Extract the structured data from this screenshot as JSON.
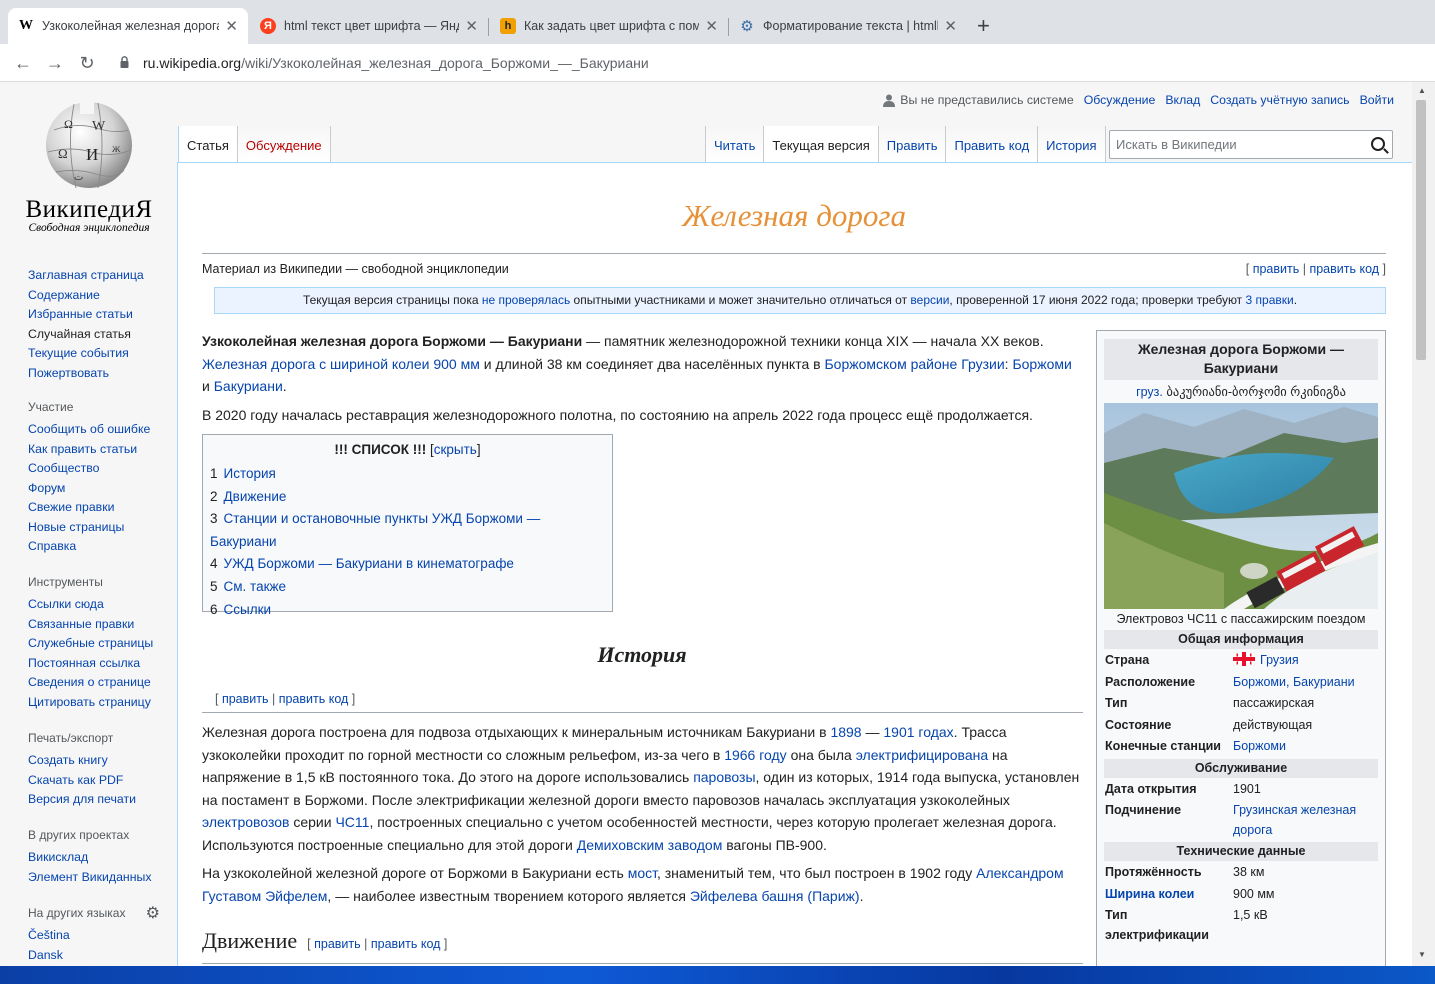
{
  "browser": {
    "tabs": [
      {
        "title": "Узкоколейная железная дорога",
        "favicon": "W"
      },
      {
        "title": "html текст цвет шрифта — Яндекс",
        "favicon": "Я"
      },
      {
        "title": "Как задать цвет шрифта с помо",
        "favicon": "h"
      },
      {
        "title": "Форматирование текста | htmlb",
        "favicon": "gear"
      }
    ],
    "url_host": "ru.wikipedia.org",
    "url_path": "/wiki/Узкоколейная_железная_дорога_Боржоми_—_Бакуриани"
  },
  "wiki": {
    "name": "ВикипедиЯ",
    "tagline": "Свободная энциклопедия",
    "nav": [
      "Заглавная страница",
      "Содержание",
      "Избранные статьи",
      "Случайная статья",
      "Текущие события",
      "Пожертвовать"
    ],
    "participation_heading": "Участие",
    "participation": [
      "Сообщить об ошибке",
      "Как править статьи",
      "Сообщество",
      "Форум",
      "Свежие правки",
      "Новые страницы",
      "Справка"
    ],
    "tools_heading": "Инструменты",
    "tools": [
      "Ссылки сюда",
      "Связанные правки",
      "Служебные страницы",
      "Постоянная ссылка",
      "Сведения о странице",
      "Цитировать страницу"
    ],
    "print_heading": "Печать/экспорт",
    "print": [
      "Создать книгу",
      "Скачать как PDF",
      "Версия для печати"
    ],
    "projects_heading": "В других проектах",
    "projects": [
      "Викисклад",
      "Элемент Викиданных"
    ],
    "langs_heading": "На других языках",
    "langs": [
      "Čeština",
      "Dansk"
    ]
  },
  "personal": {
    "anon": "Вы не представились системе",
    "links": [
      "Обсуждение",
      "Вклад",
      "Создать учётную запись",
      "Войти"
    ]
  },
  "page_tabs": {
    "left": [
      "Статья",
      "Обсуждение"
    ],
    "right": [
      "Читать",
      "Текущая версия",
      "Править",
      "Править код",
      "История"
    ]
  },
  "search_placeholder": "Искать в Википедии",
  "article": {
    "title": "Железная дорога",
    "from": "Материал из Википедии — свободной энциклопедии",
    "edit_links": {
      "edit": "править",
      "edit_code": "править код"
    },
    "notice": {
      "p1": "Текущая версия страницы пока ",
      "l1": "не проверялась",
      "p2": " опытными участниками и может значительно отличаться от ",
      "l2": "версии",
      "p3": ", проверенной 17 июня 2022 года; проверки требуют ",
      "l3": "3 правки",
      "p4": "."
    },
    "lead": {
      "bold": "Узкоколейная железная дорога Боржоми — Бакуриани",
      "t1": " — памятник железнодорожной техники конца XIX — начала XX веков. ",
      "l1": "Железная дорога с шириной колеи 900 мм",
      "t2": " и длиной 38 км соединяет два населённых пункта в ",
      "l2": "Боржомском районе",
      "t3": " ",
      "l3": "Грузии",
      "t4": ": ",
      "l4": "Боржоми",
      "t5": " и ",
      "l5": "Бакуриани",
      "t6": "."
    },
    "para2": "В 2020 году началась реставрация железнодорожного полотна, по состоянию на апрель 2022 года процесс ещё продолжается.",
    "toc": {
      "title": "!!! СПИСОК !!!",
      "hide": "скрыть",
      "items": [
        {
          "num": "1",
          "text": "История"
        },
        {
          "num": "2",
          "text": "Движение"
        },
        {
          "num": "3",
          "text": "Станции и остановочные пункты УЖД Боржоми — Бакуриани"
        },
        {
          "num": "4",
          "text": "УЖД Боржоми — Бакуриани в кинематографе"
        },
        {
          "num": "5",
          "text": "См. также"
        },
        {
          "num": "6",
          "text": "Ссылки"
        }
      ]
    },
    "history_heading": "История",
    "history_p1": {
      "t1": "Железная дорога построена для подвоза отдыхающих к минеральным источникам Бакуриани в ",
      "l1": "1898",
      "t2": " — ",
      "l2": "1901 годах",
      "t3": ". Трасса узкоколейки проходит по горной местности со сложным рельефом, из-за чего в ",
      "l3": "1966 году",
      "t4": " она была ",
      "l4": "электрифицирована",
      "t5": " на напряжение в 1,5 кВ постоянного тока. До этого на дороге использовались ",
      "l5": "паровозы",
      "t6": ", один из которых, 1914 года выпуска, установлен на постамент в Боржоми. После электрификации железной дороги вместо паровозов началась эксплуатация узкоколейных ",
      "l6": "электровозов",
      "t7": " серии ",
      "l7": "ЧС11",
      "t8": ", построенных специально с учетом особенностей местности, через которую пролегает железная дорога. Используются построенные специально для этой дороги ",
      "l8": "Демиховским заводом",
      "t9": " вагоны ПВ-900."
    },
    "history_p2": {
      "t1": "На узкоколейной железной дороге от Боржоми в Бакуриани есть ",
      "l1": "мост",
      "t2": ", знаменитый тем, что был построен в 1902 году ",
      "l2": "Александром Густавом Эйфелем",
      "t3": ", — наиболее известным творением которого является ",
      "l3": "Эйфелева башня",
      "t4": " ",
      "l4": "(Париж)",
      "t5": "."
    },
    "movement_heading": "Движение"
  },
  "infobox": {
    "title": "Железная дорога Боржоми — Бакуриани",
    "lang_label": "груз.",
    "native": "ბაკურიანი-ბორჯომი რკინიგზა",
    "caption": "Электровоз ЧС11 с пассажирским поездом",
    "sec_general": "Общая информация",
    "general": [
      {
        "k": "Страна",
        "v": "Грузия",
        "link": true,
        "flag": true
      },
      {
        "k": "Расположение",
        "v": "Боржоми, Бакуриани",
        "link": true
      },
      {
        "k": "Тип",
        "v": "пассажирская",
        "link": false
      },
      {
        "k": "Состояние",
        "v": "действующая",
        "link": false
      },
      {
        "k": "Конечные станции",
        "v": "Боржоми",
        "link": true
      }
    ],
    "sec_service": "Обслуживание",
    "service": [
      {
        "k": "Дата открытия",
        "v": "1901",
        "link": false
      },
      {
        "k": "Подчинение",
        "v": "Грузинская железная дорога",
        "link": true
      }
    ],
    "sec_tech": "Технические данные",
    "tech": [
      {
        "k": "Протяжённость",
        "v": "38 км",
        "link": false
      },
      {
        "k": "Ширина колеи",
        "v": "900 мм",
        "link": false,
        "klink": true
      },
      {
        "k": "Тип электрификации",
        "v": "1,5 кВ",
        "link": false
      }
    ]
  },
  "colors": {
    "title": "#e69138",
    "link": "#0645ad",
    "red_link": "#ba0000"
  }
}
